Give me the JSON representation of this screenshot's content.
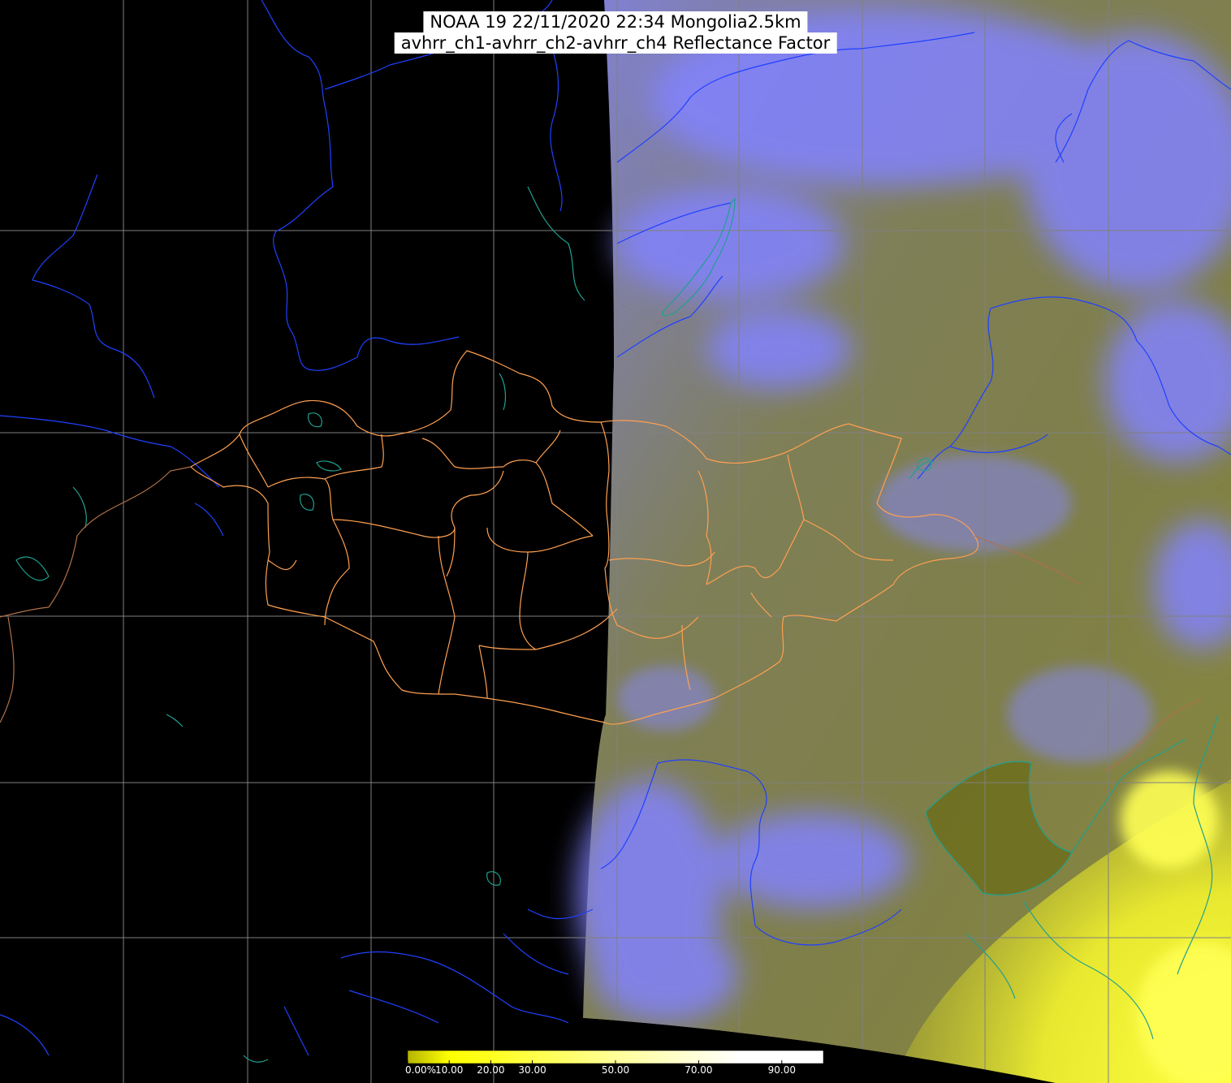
{
  "title": {
    "line1": "NOAA 19 22/11/2020 22:34 Mongolia2.5km",
    "line2": "avhrr_ch1-avhrr_ch2-avhrr_ch4 Reflectance Factor"
  },
  "colorbar": {
    "ticks": [
      "0.00%",
      "10.00",
      "20.00",
      "30.00",
      "50.00",
      "70.00",
      "90.00"
    ],
    "tick_values": [
      0,
      10,
      20,
      30,
      50,
      70,
      90
    ],
    "range": [
      0,
      100
    ],
    "stops": [
      {
        "value": 0,
        "color": "#b4b400"
      },
      {
        "value": 10,
        "color": "#ffff00"
      },
      {
        "value": 20,
        "color": "#ffff20"
      },
      {
        "value": 50,
        "color": "#ffff99"
      },
      {
        "value": 80,
        "color": "#ffffff"
      },
      {
        "value": 100,
        "color": "#ffffff"
      }
    ]
  },
  "colors": {
    "background": "#000000",
    "cloud": "#8080ff",
    "land": "#7f7f40",
    "bright_land": "#ffff33",
    "grid": "#808080",
    "borders": "#ffa050",
    "rivers": "#2040ff",
    "coastline": "#20a090"
  }
}
